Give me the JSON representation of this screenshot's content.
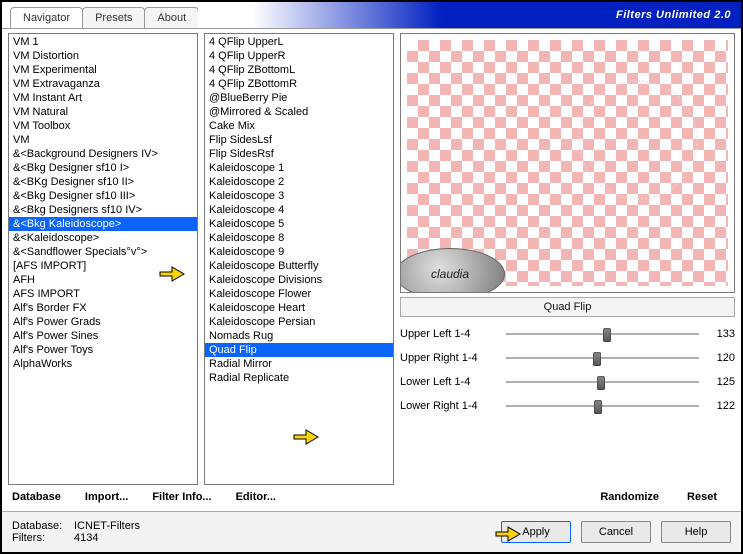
{
  "brand": "Filters Unlimited 2.0",
  "tabs": [
    {
      "label": "Navigator",
      "active": true
    },
    {
      "label": "Presets",
      "active": false
    },
    {
      "label": "About",
      "active": false
    }
  ],
  "categories": [
    "VM 1",
    "VM Distortion",
    "VM Experimental",
    "VM Extravaganza",
    "VM Instant Art",
    "VM Natural",
    "VM Toolbox",
    "VM",
    "&<Background Designers IV>",
    "&<Bkg Designer sf10 I>",
    "&<BKg Designer sf10 II>",
    "&<Bkg Designer sf10 III>",
    "&<Bkg Designers sf10 IV>",
    "&<Bkg Kaleidoscope>",
    "&<Kaleidoscope>",
    "&<Sandflower Specials°v°>",
    "[AFS IMPORT]",
    "AFH",
    "AFS IMPORT",
    "Alf's Border FX",
    "Alf's Power Grads",
    "Alf's Power Sines",
    "Alf's Power Toys",
    "AlphaWorks"
  ],
  "categories_selected_index": 13,
  "filters": [
    "4 QFlip UpperL",
    "4 QFlip UpperR",
    "4 QFlip ZBottomL",
    "4 QFlip ZBottomR",
    "@BlueBerry Pie",
    "@Mirrored & Scaled",
    "Cake Mix",
    "Flip SidesLsf",
    "Flip SidesRsf",
    "Kaleidoscope 1",
    "Kaleidoscope 2",
    "Kaleidoscope 3",
    "Kaleidoscope 4",
    "Kaleidoscope 5",
    "Kaleidoscope 8",
    "Kaleidoscope 9",
    "Kaleidoscope Butterfly",
    "Kaleidoscope Divisions",
    "Kaleidoscope Flower",
    "Kaleidoscope Heart",
    "Kaleidoscope Persian",
    "Nomads Rug",
    "Quad Flip",
    "Radial Mirror",
    "Radial Replicate"
  ],
  "filters_selected_index": 22,
  "preview": {
    "badge": "claudia"
  },
  "current_filter_name": "Quad Flip",
  "sliders": [
    {
      "label": "Upper Left 1-4",
      "value": 133,
      "min": 0,
      "max": 255
    },
    {
      "label": "Upper Right 1-4",
      "value": 120,
      "min": 0,
      "max": 255
    },
    {
      "label": "Lower Left 1-4",
      "value": 125,
      "min": 0,
      "max": 255
    },
    {
      "label": "Lower Right 1-4",
      "value": 122,
      "min": 0,
      "max": 255
    }
  ],
  "footer1": {
    "left": [
      "Database",
      "Import...",
      "Filter Info...",
      "Editor..."
    ],
    "right": [
      "Randomize",
      "Reset"
    ]
  },
  "status": {
    "database_key": "Database:",
    "database_val": "ICNET-Filters",
    "filters_key": "Filters:",
    "filters_val": "4134"
  },
  "buttons": {
    "apply": "Apply",
    "cancel": "Cancel",
    "help": "Help"
  }
}
